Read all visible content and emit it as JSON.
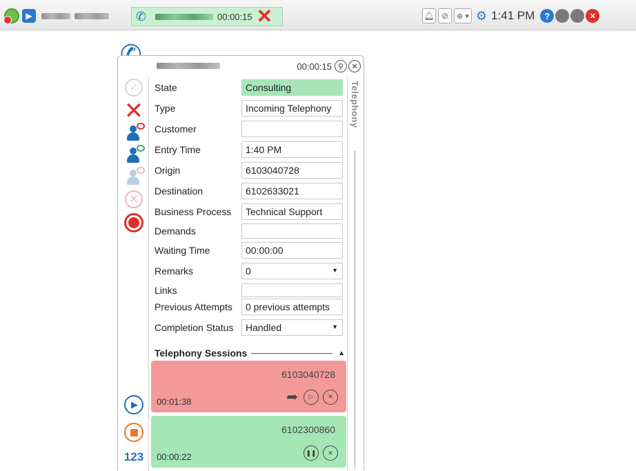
{
  "topbar": {
    "call_tab_timer": "00:00:15",
    "clock": "1:41 PM",
    "help_label": "?"
  },
  "panel": {
    "timer": "00:00:15",
    "side_tab_label": "Telephony",
    "keypad_label": "123"
  },
  "fields": [
    {
      "label": "State",
      "value": "Consulting"
    },
    {
      "label": "Type",
      "value": "Incoming Telephony"
    },
    {
      "label": "Customer",
      "value": ""
    },
    {
      "label": "Entry Time",
      "value": "1:40 PM"
    },
    {
      "label": "Origin",
      "value": "6103040728"
    },
    {
      "label": "Destination",
      "value": "6102633021"
    },
    {
      "label": "Business Process",
      "value": "Technical Support"
    },
    {
      "label": "Demands",
      "value": ""
    },
    {
      "label": "Waiting Time",
      "value": "00:00:00"
    },
    {
      "label": "Remarks",
      "value": "0"
    },
    {
      "label": "Links",
      "value": ""
    },
    {
      "label": "Previous Attempts",
      "value": "0 previous attempts"
    },
    {
      "label": "Completion Status",
      "value": "Handled"
    }
  ],
  "sessions": {
    "title": "Telephony Sessions",
    "items": [
      {
        "number": "6103040728",
        "timer": "00:01:38",
        "color": "#f39a98"
      },
      {
        "number": "6102300860",
        "timer": "00:00:22",
        "color": "#a4e6b4"
      }
    ]
  },
  "colors": {
    "accent_blue": "#1d6fb8",
    "danger_red": "#e0302a",
    "state_green": "#a7e6b7",
    "stop_orange": "#ee7a22"
  }
}
